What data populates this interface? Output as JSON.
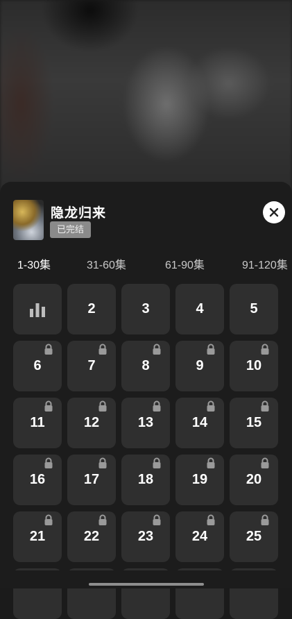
{
  "drama": {
    "title": "隐龙归来",
    "status_badge": "已完结"
  },
  "tabs": [
    {
      "label": "1-30集",
      "active": true
    },
    {
      "label": "31-60集",
      "active": false
    },
    {
      "label": "61-90集",
      "active": false
    },
    {
      "label": "91-120集",
      "active": false
    }
  ],
  "episodes": [
    {
      "label": "",
      "playing": true,
      "locked": false
    },
    {
      "label": "2",
      "locked": false
    },
    {
      "label": "3",
      "locked": false
    },
    {
      "label": "4",
      "locked": false
    },
    {
      "label": "5",
      "locked": false
    },
    {
      "label": "6",
      "locked": true
    },
    {
      "label": "7",
      "locked": true
    },
    {
      "label": "8",
      "locked": true
    },
    {
      "label": "9",
      "locked": true
    },
    {
      "label": "10",
      "locked": true
    },
    {
      "label": "11",
      "locked": true
    },
    {
      "label": "12",
      "locked": true
    },
    {
      "label": "13",
      "locked": true
    },
    {
      "label": "14",
      "locked": true
    },
    {
      "label": "15",
      "locked": true
    },
    {
      "label": "16",
      "locked": true
    },
    {
      "label": "17",
      "locked": true
    },
    {
      "label": "18",
      "locked": true
    },
    {
      "label": "19",
      "locked": true
    },
    {
      "label": "20",
      "locked": true
    },
    {
      "label": "21",
      "locked": true
    },
    {
      "label": "22",
      "locked": true
    },
    {
      "label": "23",
      "locked": true
    },
    {
      "label": "24",
      "locked": true
    },
    {
      "label": "25",
      "locked": true
    },
    {
      "label": "",
      "locked": true
    },
    {
      "label": "",
      "locked": true
    },
    {
      "label": "",
      "locked": true
    },
    {
      "label": "",
      "locked": true
    },
    {
      "label": "",
      "locked": true
    }
  ],
  "icons": {
    "close": "close-icon",
    "lock": "lock-icon",
    "playing": "playing-bars-icon"
  },
  "colors": {
    "sheet_bg": "#1c1c1c",
    "cell_bg": "#2f2f2f",
    "badge_bg": "#8a8a8a"
  }
}
